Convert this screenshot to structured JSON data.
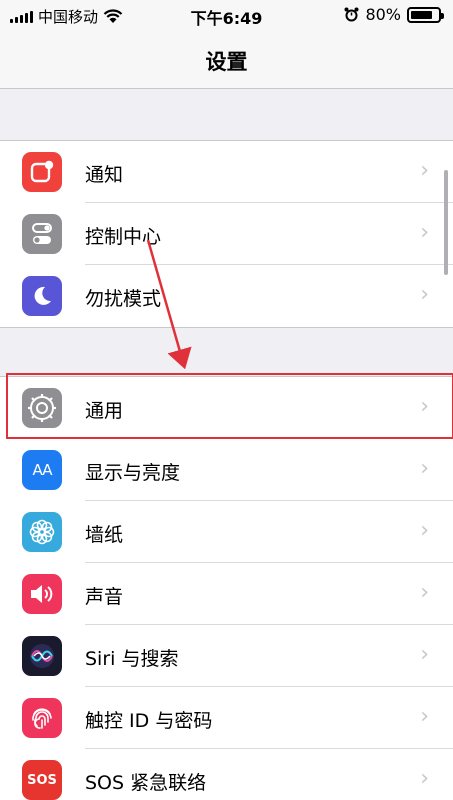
{
  "status_bar": {
    "carrier": "中国移动",
    "time": "下午6:49",
    "battery_percent": "80%",
    "battery_level": 0.8,
    "icons": [
      "signal-icon",
      "wifi-icon",
      "alarm-icon",
      "battery-icon"
    ]
  },
  "nav": {
    "title": "设置"
  },
  "groups": [
    {
      "items": [
        {
          "label": "通知",
          "icon": "notifications-icon",
          "color": "#f0413c"
        },
        {
          "label": "控制中心",
          "icon": "control-center-icon",
          "color": "#8e8e93"
        },
        {
          "label": "勿扰模式",
          "icon": "moon-icon",
          "color": "#5856d6"
        }
      ]
    },
    {
      "items": [
        {
          "label": "通用",
          "icon": "gear-icon",
          "color": "#8e8e93"
        },
        {
          "label": "显示与亮度",
          "icon": "display-brightness-icon",
          "color": "#1e7cf2",
          "icon_text": "AA"
        },
        {
          "label": "墙纸",
          "icon": "wallpaper-flower-icon",
          "color": "#36aadc"
        },
        {
          "label": "声音",
          "icon": "speaker-icon",
          "color": "#f0355c"
        },
        {
          "label": "Siri 与搜索",
          "icon": "siri-icon",
          "color": "#1a1a2e"
        },
        {
          "label": "触控 ID 与密码",
          "icon": "fingerprint-icon",
          "color": "#f0355c"
        },
        {
          "label": "SOS 紧急联络",
          "icon": "sos-icon",
          "color": "#e6342f",
          "icon_text": "SOS"
        }
      ]
    }
  ],
  "annotation": {
    "highlight_color": "#e0313b",
    "highlighted_item": "通用"
  }
}
